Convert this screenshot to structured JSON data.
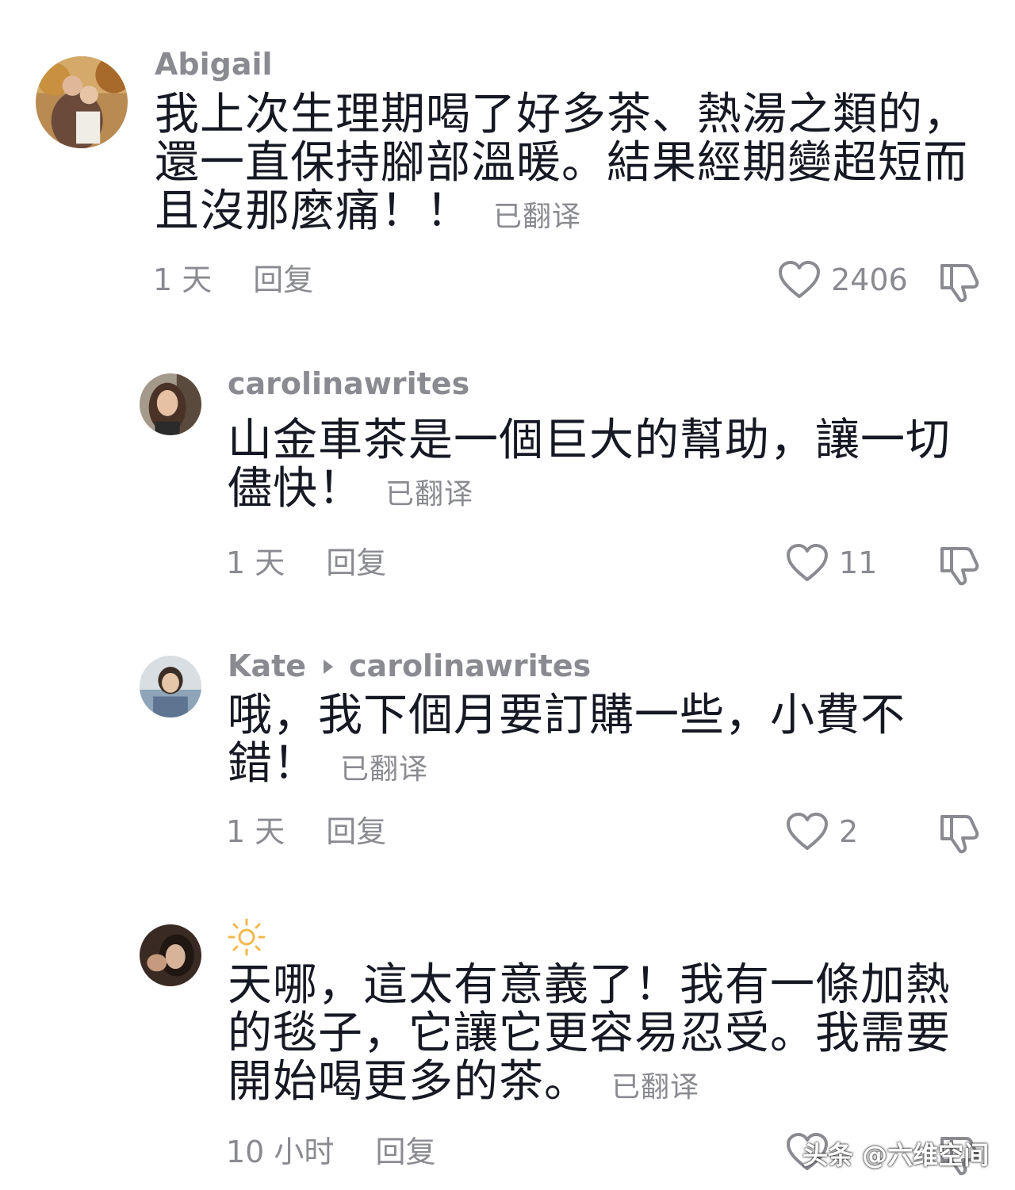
{
  "comments": [
    {
      "username": "Abigail",
      "text": "我上次生理期喝了好多茶、熱湯之類的，還一直保持腳部溫暖。結果經期變超短而且沒那麼痛！！",
      "translated_label": "已翻译",
      "time": "1 天",
      "reply_label": "回复",
      "likes": "2406"
    },
    {
      "username": "carolinawrites",
      "text": "山金車茶是一個巨大的幫助，讓一切儘快！",
      "translated_label": "已翻译",
      "time": "1 天",
      "reply_label": "回复",
      "likes": "11"
    },
    {
      "username": "Kate",
      "reply_to": "carolinawrites",
      "text": "哦，我下個月要訂購一些，小費不錯！",
      "translated_label": "已翻译",
      "time": "1 天",
      "reply_label": "回复",
      "likes": "2"
    },
    {
      "username": "",
      "username_icon": "sun-icon",
      "text": "天哪，這太有意義了！我有一條加熱的毯子，它讓它更容易忍受。我需要開始喝更多的茶。",
      "translated_label": "已翻译",
      "time": "10 小时",
      "reply_label": "回复",
      "likes": ""
    }
  ],
  "watermark": "头条 @六维空间",
  "icons": [
    "heart-icon",
    "thumbs-down-icon",
    "sun-icon",
    "avatar"
  ],
  "colors": {
    "text": "#161823",
    "secondary": "#8a8b91",
    "background": "#ffffff"
  }
}
